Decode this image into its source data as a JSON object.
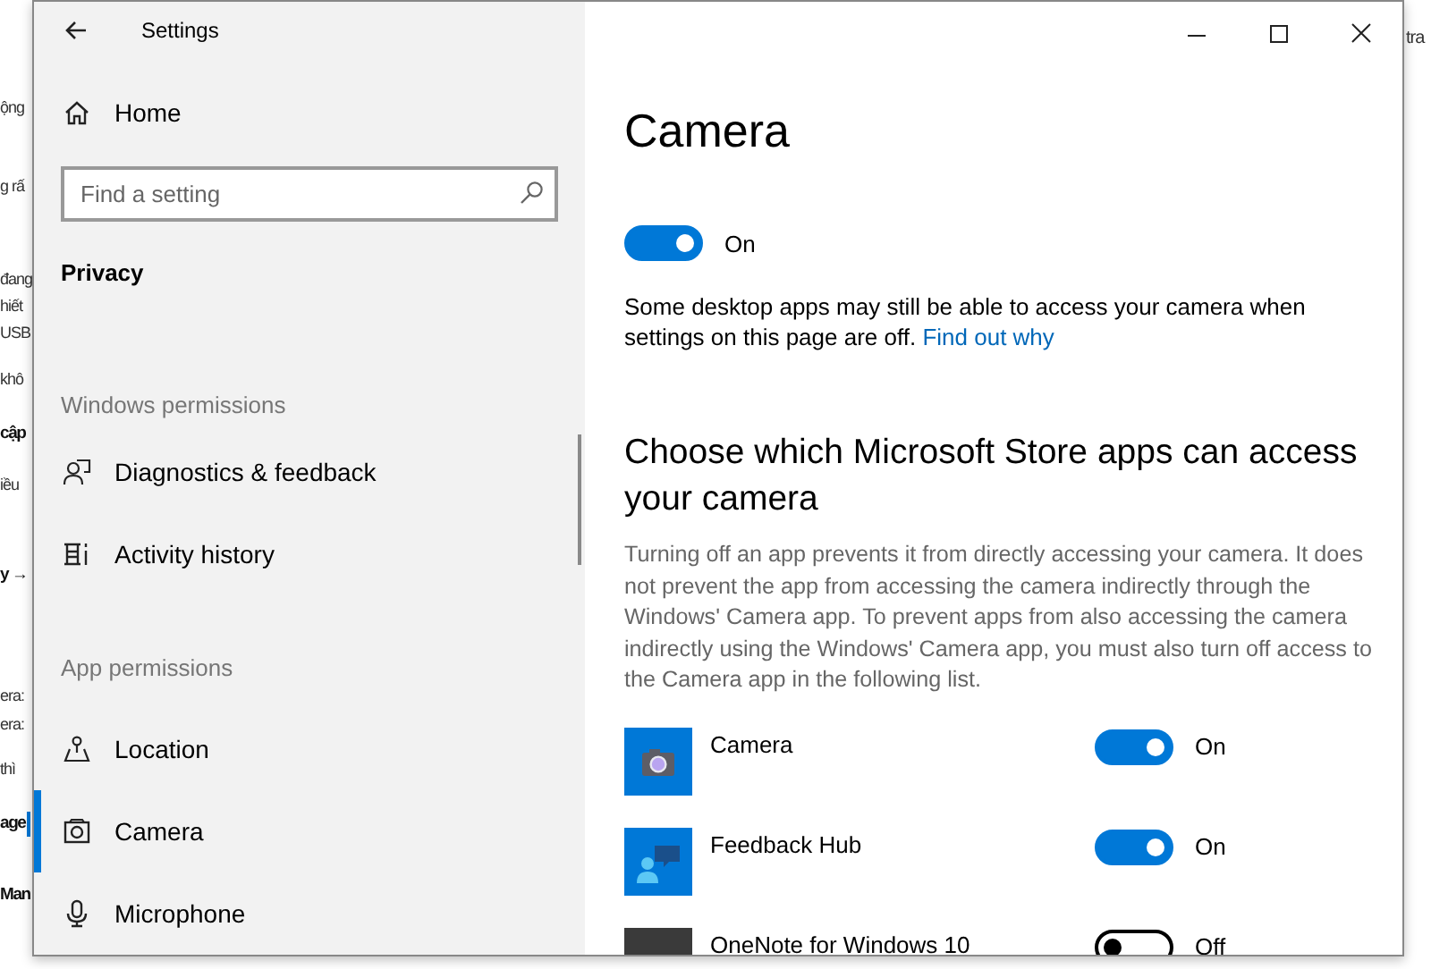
{
  "background_window": {
    "left_fragments": [
      {
        "text": "ộng",
        "bold": false,
        "selected": false
      },
      {
        "text": "g rấ",
        "bold": false,
        "selected": false
      },
      {
        "text": "đang",
        "bold": false,
        "selected": false
      },
      {
        "text": "hiết",
        "bold": false,
        "selected": false
      },
      {
        "text": "USB",
        "bold": false,
        "selected": false
      },
      {
        "text": "khô",
        "bold": false,
        "selected": false
      },
      {
        "text": "cập",
        "bold": true,
        "selected": false
      },
      {
        "text": "iều",
        "bold": false,
        "selected": false
      },
      {
        "text": "y →",
        "bold": true,
        "selected": false
      },
      {
        "text": "era:",
        "bold": false,
        "selected": false
      },
      {
        "text": "era:",
        "bold": false,
        "selected": false
      },
      {
        "text": "thì",
        "bold": false,
        "selected": false
      },
      {
        "text": "age",
        "bold": true,
        "selected": true
      },
      {
        "text": "Man",
        "bold": true,
        "selected": false
      }
    ],
    "right_fragments": [
      {
        "text": "tra"
      }
    ]
  },
  "window": {
    "title": "Settings"
  },
  "sidebar": {
    "home": "Home",
    "search": {
      "placeholder": "Find a setting"
    },
    "section_title": "Privacy",
    "groups": [
      {
        "heading": "Windows permissions",
        "items": [
          {
            "label": "Diagnostics & feedback",
            "kind": "diagnostics",
            "selected": false
          },
          {
            "label": "Activity history",
            "kind": "activity",
            "selected": false
          }
        ]
      },
      {
        "heading": "App permissions",
        "items": [
          {
            "label": "Location",
            "kind": "location",
            "selected": false
          },
          {
            "label": "Camera",
            "kind": "camera",
            "selected": true
          },
          {
            "label": "Microphone",
            "kind": "microphone",
            "selected": false
          }
        ]
      }
    ]
  },
  "content": {
    "title": "Camera",
    "master_toggle": {
      "on": true,
      "label": "On"
    },
    "note": "Some desktop apps may still be able to access your camera when settings on this page are off.",
    "note_link": "Find out why",
    "section_heading": "Choose which Microsoft Store apps can access your camera",
    "section_text": "Turning off an app prevents it from directly accessing your camera. It does not prevent the app from accessing the camera indirectly through the Windows' Camera app. To prevent apps from also accessing the camera indirectly using the Windows' Camera app, you must also turn off access to the Camera app in the following list.",
    "apps": [
      {
        "name": "Camera",
        "kind": "camera",
        "on": true,
        "state_label": "On"
      },
      {
        "name": "Feedback Hub",
        "kind": "feedback",
        "on": true,
        "state_label": "On"
      },
      {
        "name": "OneNote for Windows 10",
        "kind": "onenote",
        "on": false,
        "state_label": "Off"
      }
    ]
  }
}
